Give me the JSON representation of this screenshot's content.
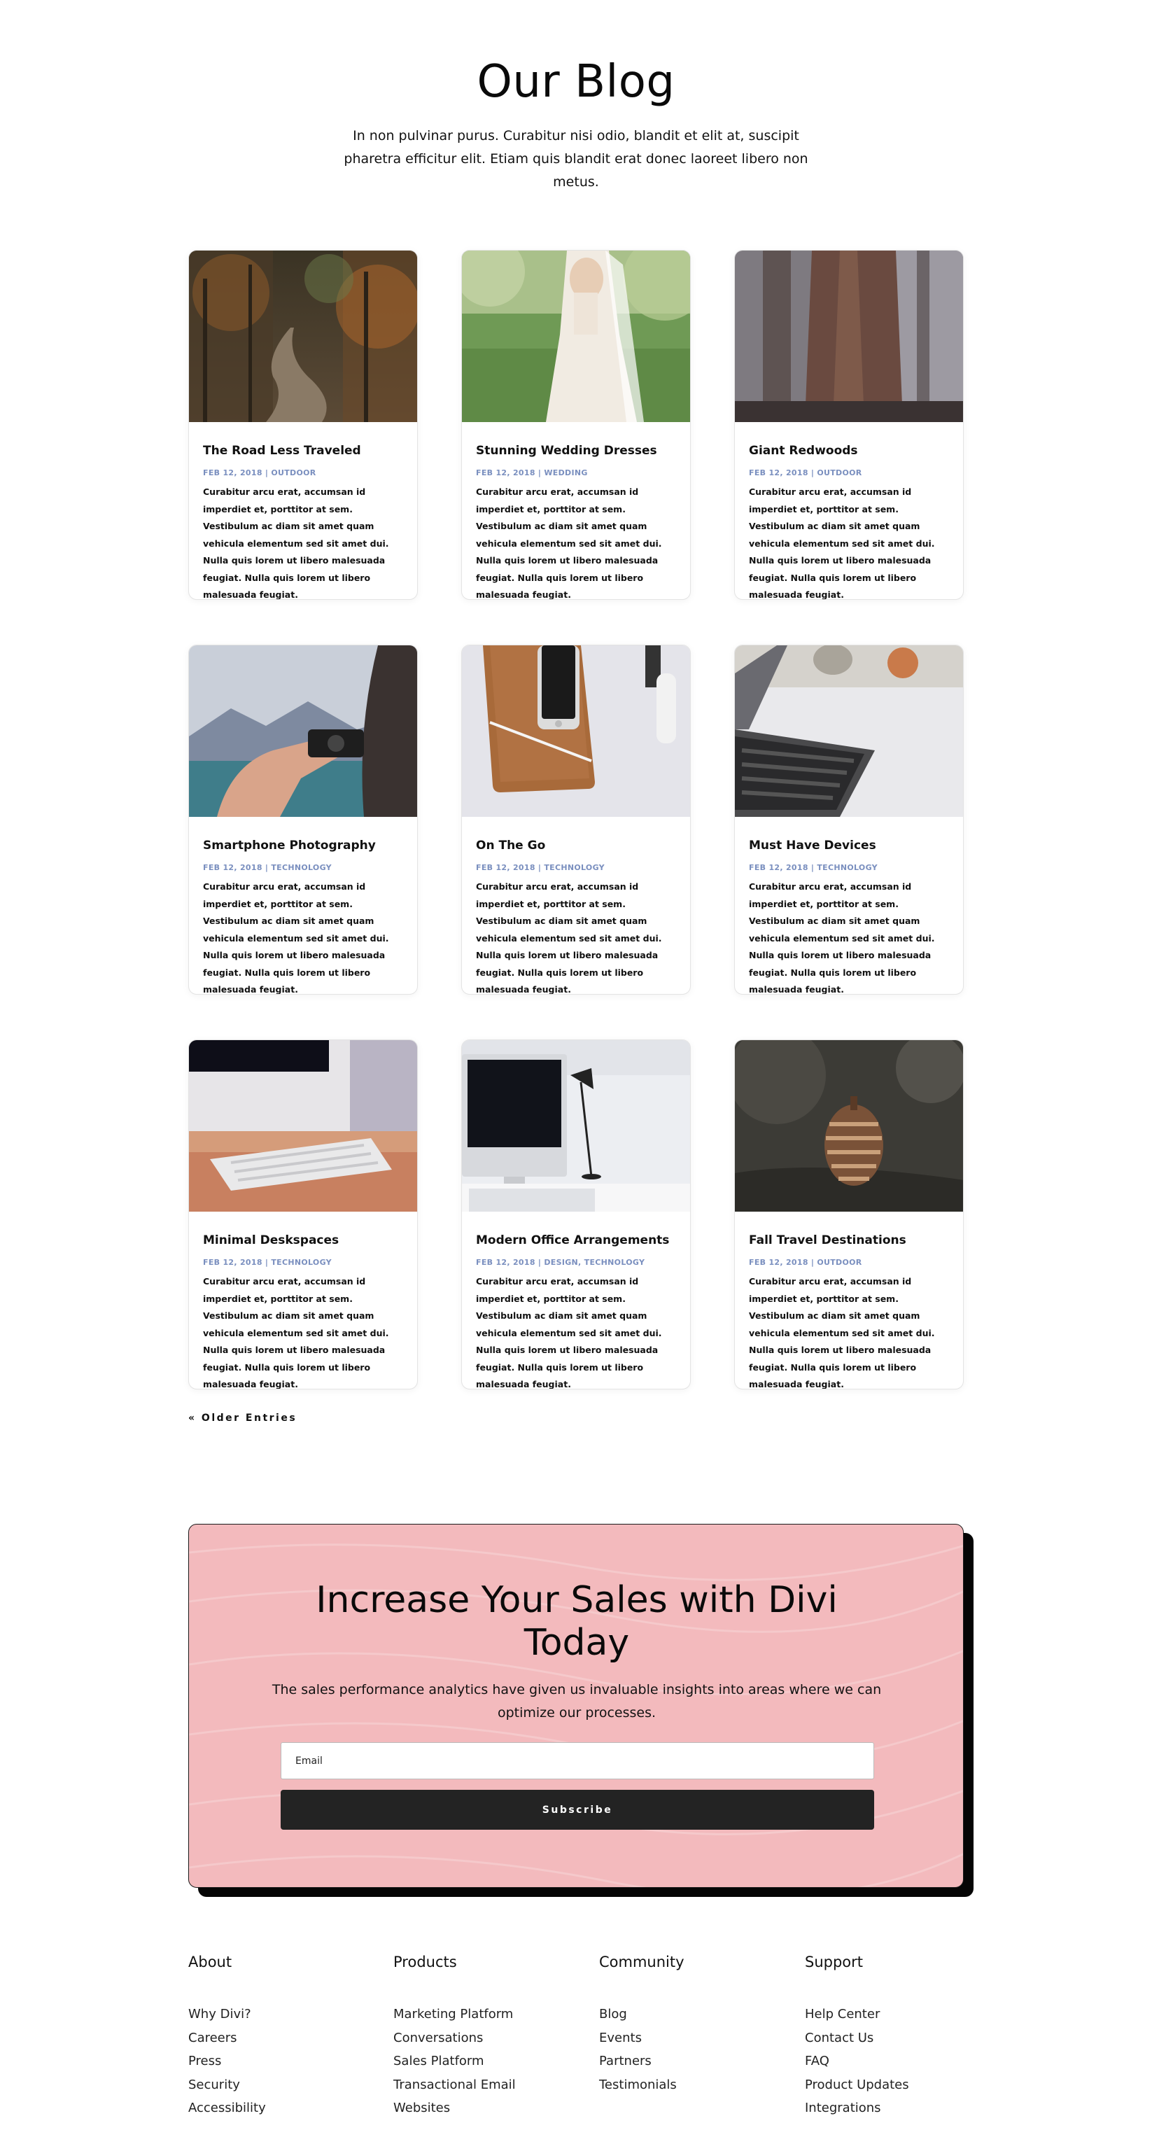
{
  "hero": {
    "title": "Our Blog",
    "subtitle": "In non pulvinar purus. Curabitur nisi odio, blandit et elit at, suscipit pharetra efficitur elit. Etiam quis blandit erat donec laoreet libero non metus."
  },
  "posts": [
    {
      "title": "The Road Less Traveled",
      "date": "FEB 12, 2018",
      "categories": "OUTDOOR",
      "excerpt": "Curabitur arcu erat, accumsan id imperdiet et, porttitor at sem. Vestibulum ac diam sit amet quam vehicula elementum sed sit amet dui. Nulla quis lorem ut libero malesuada feugiat. Nulla quis lorem ut libero malesuada feugiat."
    },
    {
      "title": "Stunning Wedding Dresses",
      "date": "FEB 12, 2018",
      "categories": "WEDDING",
      "excerpt": "Curabitur arcu erat, accumsan id imperdiet et, porttitor at sem. Vestibulum ac diam sit amet quam vehicula elementum sed sit amet dui. Nulla quis lorem ut libero malesuada feugiat. Nulla quis lorem ut libero malesuada feugiat."
    },
    {
      "title": "Giant Redwoods",
      "date": "FEB 12, 2018",
      "categories": "OUTDOOR",
      "excerpt": "Curabitur arcu erat, accumsan id imperdiet et, porttitor at sem. Vestibulum ac diam sit amet quam vehicula elementum sed sit amet dui. Nulla quis lorem ut libero malesuada feugiat. Nulla quis lorem ut libero malesuada feugiat."
    },
    {
      "title": "Smartphone Photography",
      "date": "FEB 12, 2018",
      "categories": "TECHNOLOGY",
      "excerpt": "Curabitur arcu erat, accumsan id imperdiet et, porttitor at sem. Vestibulum ac diam sit amet quam vehicula elementum sed sit amet dui. Nulla quis lorem ut libero malesuada feugiat. Nulla quis lorem ut libero malesuada feugiat."
    },
    {
      "title": "On The Go",
      "date": "FEB 12, 2018",
      "categories": "TECHNOLOGY",
      "excerpt": "Curabitur arcu erat, accumsan id imperdiet et, porttitor at sem. Vestibulum ac diam sit amet quam vehicula elementum sed sit amet dui. Nulla quis lorem ut libero malesuada feugiat. Nulla quis lorem ut libero malesuada feugiat."
    },
    {
      "title": "Must Have Devices",
      "date": "FEB 12, 2018",
      "categories": "TECHNOLOGY",
      "excerpt": "Curabitur arcu erat, accumsan id imperdiet et, porttitor at sem. Vestibulum ac diam sit amet quam vehicula elementum sed sit amet dui. Nulla quis lorem ut libero malesuada feugiat. Nulla quis lorem ut libero malesuada feugiat."
    },
    {
      "title": "Minimal Deskspaces",
      "date": "FEB 12, 2018",
      "categories": "TECHNOLOGY",
      "excerpt": "Curabitur arcu erat, accumsan id imperdiet et, porttitor at sem. Vestibulum ac diam sit amet quam vehicula elementum sed sit amet dui. Nulla quis lorem ut libero malesuada feugiat. Nulla quis lorem ut libero malesuada feugiat."
    },
    {
      "title": "Modern Office Arrangements",
      "date": "FEB 12, 2018",
      "categories": "DESIGN, TECHNOLOGY",
      "excerpt": "Curabitur arcu erat, accumsan id imperdiet et, porttitor at sem. Vestibulum ac diam sit amet quam vehicula elementum sed sit amet dui. Nulla quis lorem ut libero malesuada feugiat. Nulla quis lorem ut libero malesuada feugiat."
    },
    {
      "title": "Fall Travel Destinations",
      "date": "FEB 12, 2018",
      "categories": "OUTDOOR",
      "excerpt": "Curabitur arcu erat, accumsan id imperdiet et, porttitor at sem. Vestibulum ac diam sit amet quam vehicula elementum sed sit amet dui. Nulla quis lorem ut libero malesuada feugiat. Nulla quis lorem ut libero malesuada feugiat."
    }
  ],
  "pagination": {
    "older_label": "« Older Entries"
  },
  "cta": {
    "title": "Increase Your Sales with Divi Today",
    "text": "The sales performance analytics have given us invaluable insights into areas where we can optimize our processes.",
    "email_placeholder": "Email",
    "button_label": "Subscribe",
    "bg_color": "#f3babd"
  },
  "footer": {
    "columns": [
      {
        "title": "About",
        "links": [
          "Why Divi?",
          "Careers",
          "Press",
          "Security",
          "Accessibility"
        ]
      },
      {
        "title": "Products",
        "links": [
          "Marketing Platform",
          "Conversations",
          "Sales Platform",
          "Transactional Email",
          "Websites"
        ]
      },
      {
        "title": "Community",
        "links": [
          "Blog",
          "Events",
          "Partners",
          "Testimonials"
        ]
      },
      {
        "title": "Support",
        "links": [
          "Help Center",
          "Contact Us",
          "FAQ",
          "Product Updates",
          "Integrations"
        ]
      }
    ]
  },
  "colors": {
    "meta_blue": "#7a8fbf",
    "button_dark": "#232323",
    "cta_pink": "#f3babd"
  }
}
